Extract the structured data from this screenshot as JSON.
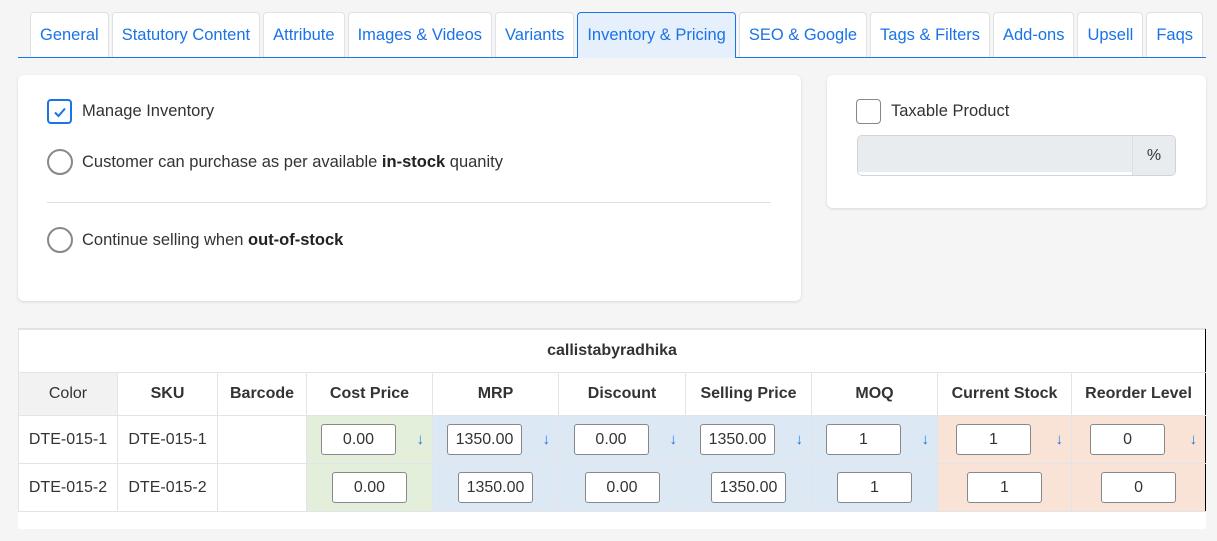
{
  "tabs": [
    {
      "label": "General",
      "active": false
    },
    {
      "label": "Statutory Content",
      "active": false
    },
    {
      "label": "Attribute",
      "active": false
    },
    {
      "label": "Images & Videos",
      "active": false
    },
    {
      "label": "Variants",
      "active": false
    },
    {
      "label": "Inventory & Pricing",
      "active": true
    },
    {
      "label": "SEO & Google",
      "active": false
    },
    {
      "label": "Tags & Filters",
      "active": false
    },
    {
      "label": "Add-ons",
      "active": false
    },
    {
      "label": "Upsell",
      "active": false
    },
    {
      "label": "Faqs",
      "active": false
    }
  ],
  "inventory": {
    "manage_label": "Manage Inventory",
    "manage_checked": true,
    "option1": {
      "prefix": "Customer can purchase as per available ",
      "bold": "in-stock",
      "suffix": " quanity",
      "selected": false
    },
    "option2": {
      "prefix": "Continue selling when ",
      "bold": "out-of-stock",
      "suffix": "",
      "selected": false
    }
  },
  "tax": {
    "label": "Taxable Product",
    "checked": false,
    "value": "",
    "unit": "%"
  },
  "variant_table": {
    "title": "callistabyradhika",
    "columns": [
      "Color",
      "SKU",
      "Barcode",
      "Cost Price",
      "MRP",
      "Discount",
      "Selling Price",
      "MOQ",
      "Current Stock",
      "Reorder Level"
    ],
    "rows": [
      {
        "color": "DTE-015-1",
        "sku": "DTE-015-1",
        "barcode": "",
        "cost_price": "0.00",
        "mrp": "1350.00",
        "discount": "0.00",
        "selling_price": "1350.00",
        "moq": "1",
        "current_stock": "1",
        "reorder_level": "0"
      },
      {
        "color": "DTE-015-2",
        "sku": "DTE-015-2",
        "barcode": "",
        "cost_price": "0.00",
        "mrp": "1350.00",
        "discount": "0.00",
        "selling_price": "1350.00",
        "moq": "1",
        "current_stock": "1",
        "reorder_level": "0"
      }
    ],
    "copy_down_icon": "arrow-down-icon"
  },
  "colors": {
    "accent": "#1a73e8",
    "cost_bg": "#e3eedb",
    "price_bg": "#dde8f5",
    "stock_bg": "#f9e3d6"
  }
}
